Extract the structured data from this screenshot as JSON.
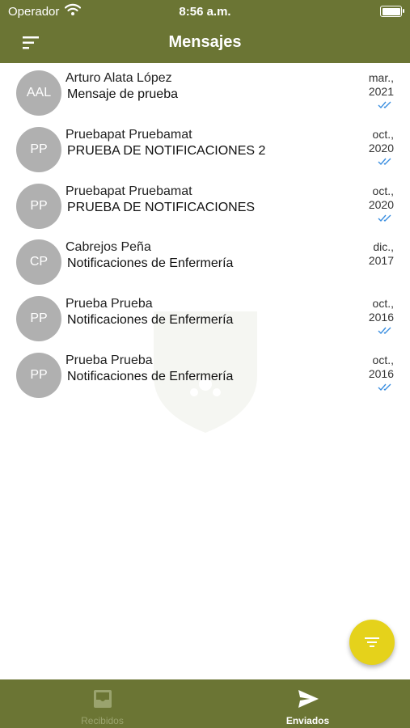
{
  "status_bar": {
    "carrier": "Operador",
    "time": "8:56 a.m."
  },
  "header": {
    "title": "Mensajes"
  },
  "messages": [
    {
      "initials": "AAL",
      "sender": "Arturo Alata López",
      "subject": "Mensaje de prueba",
      "date_line1": "mar.,",
      "date_line2": "2021"
    },
    {
      "initials": "PP",
      "sender": "Pruebapat Pruebamat",
      "subject": "PRUEBA DE NOTIFICACIONES 2",
      "date_line1": "oct.,",
      "date_line2": "2020"
    },
    {
      "initials": "PP",
      "sender": "Pruebapat Pruebamat",
      "subject": "PRUEBA DE NOTIFICACIONES",
      "date_line1": "oct.,",
      "date_line2": "2020"
    },
    {
      "initials": "CP",
      "sender": "Cabrejos Peña",
      "subject": "Notificaciones de Enfermería",
      "date_line1": "dic.,",
      "date_line2": "2017"
    },
    {
      "initials": "PP",
      "sender": "Prueba Prueba",
      "subject": "Notificaciones de Enfermería",
      "date_line1": "oct.,",
      "date_line2": "2016"
    },
    {
      "initials": "PP",
      "sender": "Prueba Prueba",
      "subject": "Notificaciones de Enfermería",
      "date_line1": "oct.,",
      "date_line2": "2016"
    }
  ],
  "tabs": [
    {
      "label": "Recibidos",
      "icon": "inbox-icon",
      "active": false
    },
    {
      "label": "Enviados",
      "icon": "send-icon",
      "active": true
    }
  ],
  "colors": {
    "bar": "#6b7534",
    "fab": "#e5d21b",
    "avatar": "#b0b0b0",
    "check": "#3a8ee0"
  }
}
